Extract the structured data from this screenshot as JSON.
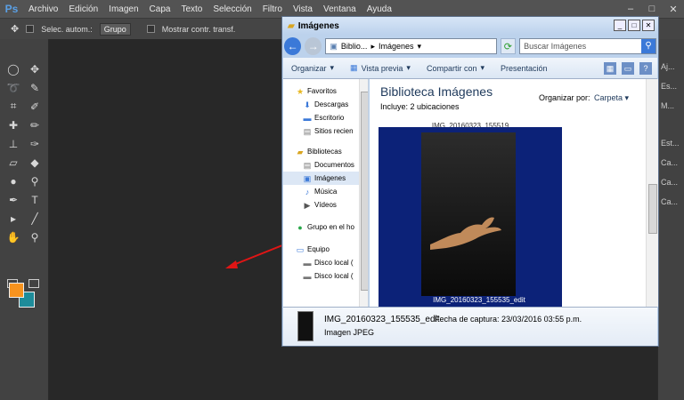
{
  "photoshop": {
    "logo": "Ps",
    "menu": [
      "Archivo",
      "Edición",
      "Imagen",
      "Capa",
      "Texto",
      "Selección",
      "Filtro",
      "Vista",
      "Ventana",
      "Ayuda"
    ],
    "window_controls": [
      "–",
      "□",
      "✕"
    ],
    "options": {
      "auto_select_label": "Selec. autom.:",
      "group_value": "Grupo",
      "show_transform_label": "Mostrar contr. transf."
    },
    "right_panel": [
      "Aj...",
      "Es...",
      "M...",
      "Est...",
      "Ca...",
      "Ca...",
      "Ca..."
    ],
    "fg_color": "#f7931e",
    "bg_color": "#1e8c9a"
  },
  "explorer": {
    "title": "Imágenes",
    "breadcrumb": [
      "Biblio...",
      "Imágenes"
    ],
    "search_placeholder": "Buscar Imágenes",
    "commands": [
      "Organizar",
      "Vista previa",
      "Compartir con",
      "Presentación"
    ],
    "nav": {
      "favorites": "Favoritos",
      "downloads": "Descargas",
      "desktop": "Escritorio",
      "recent": "Sitios recien",
      "libraries": "Bibliotecas",
      "documents": "Documentos",
      "images": "Imágenes",
      "music": "Música",
      "videos": "Vídeos",
      "homegroup": "Grupo en el ho",
      "computer": "Equipo",
      "disk1": "Disco local (",
      "disk2": "Disco local ("
    },
    "library_title": "Biblioteca Imágenes",
    "library_includes": "Incluye:  2 ubicaciones",
    "arrange_label": "Organizar por:",
    "arrange_value": "Carpeta",
    "previous_file": "IMG_20160323_155519",
    "file_label": "IMG_20160323_155535_edit",
    "details": {
      "name": "IMG_20160323_155535_edit",
      "date": "Fecha de captura: 23/03/2016 03:55 p.m.",
      "type": "Imagen JPEG"
    }
  }
}
